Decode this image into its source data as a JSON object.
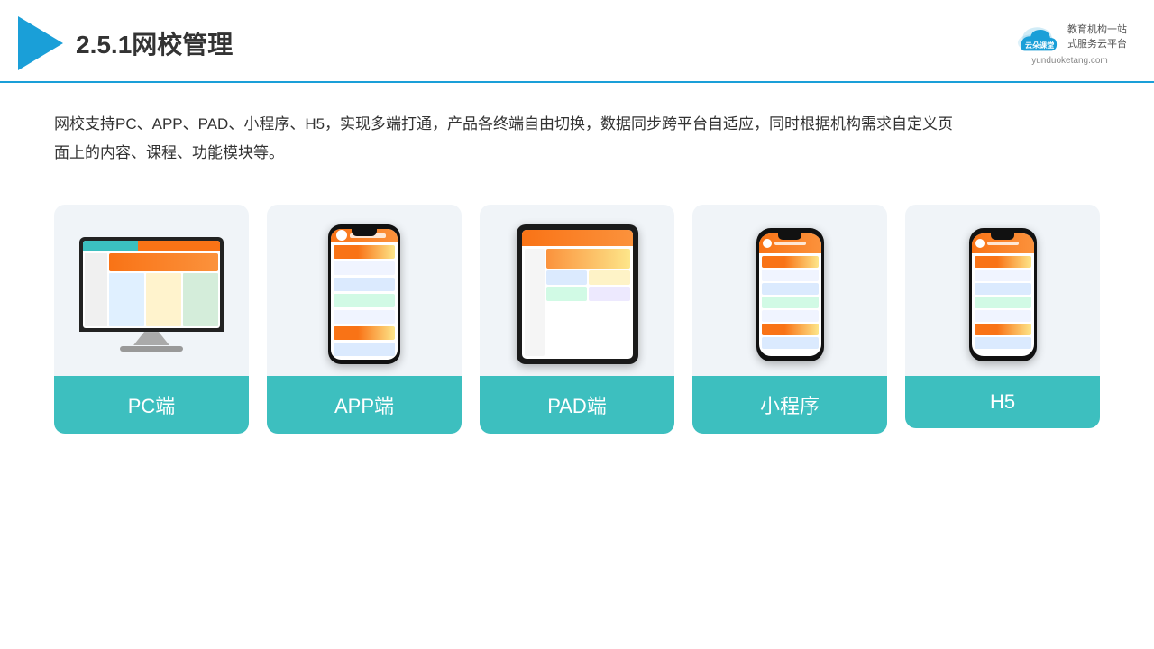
{
  "header": {
    "title": "2.5.1网校管理",
    "brand": {
      "name": "云朵课堂",
      "domain": "yunduoketang.com",
      "tagline1": "教育机构一站",
      "tagline2": "式服务云平台"
    }
  },
  "description": "网校支持PC、APP、PAD、小程序、H5，实现多端打通，产品各终端自由切换，数据同步跨平台自适应，同时根据机构需求自定义页面上的内容、课程、功能模块等。",
  "devices": [
    {
      "id": "pc",
      "label": "PC端"
    },
    {
      "id": "app",
      "label": "APP端"
    },
    {
      "id": "pad",
      "label": "PAD端"
    },
    {
      "id": "miniprogram",
      "label": "小程序"
    },
    {
      "id": "h5",
      "label": "H5"
    }
  ],
  "colors": {
    "accent": "#3dbfbf",
    "header_line": "#1a9fd8",
    "triangle": "#1a9fd8"
  }
}
